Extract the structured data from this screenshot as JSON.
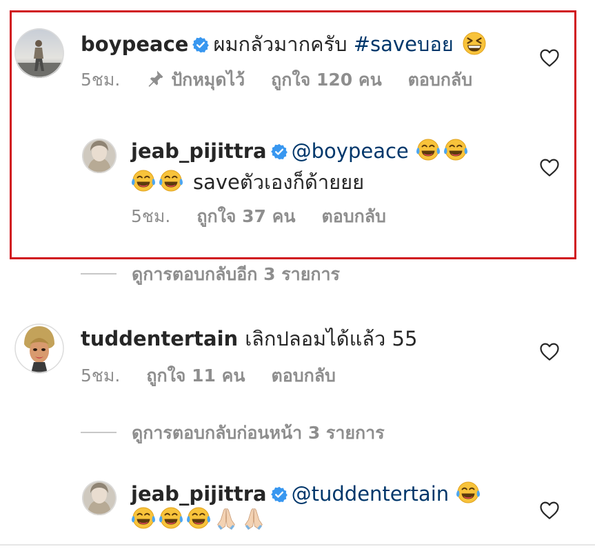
{
  "comments": [
    {
      "username": "boypeace",
      "verified": true,
      "text": "ผมกลัวมากครับ ",
      "hashtag": "#saveบอย",
      "emoji": "grinning-squinting-face",
      "time": "5ชม.",
      "pinned_label": "ปักหมุดไว้",
      "likes_label": "ถูกใจ 120 คน",
      "reply_label": "ตอบกลับ"
    },
    {
      "username": "jeab_pijittra",
      "verified": true,
      "mention": "@boypeace",
      "text_line2": "saveตัวเองก็ด้ายยย",
      "emoji": "face-with-tears-of-joy",
      "time": "5ชม.",
      "likes_label": "ถูกใจ 37 คน",
      "reply_label": "ตอบกลับ"
    },
    {
      "username": "tuddentertain",
      "verified": false,
      "text": "เลิกปลอมได้แล้ว 55",
      "time": "5ชม.",
      "likes_label": "ถูกใจ 11 คน",
      "reply_label": "ตอบกลับ"
    },
    {
      "username": "jeab_pijittra",
      "verified": true,
      "mention": "@tuddentertain",
      "emoji": "face-with-tears-of-joy",
      "emoji2": "folded-hands"
    }
  ],
  "view_more_replies": "ดูการตอบกลับอีก 3 รายการ",
  "view_previous_replies": "ดูการตอบกลับก่อนหน้า 3 รายการ",
  "colors": {
    "highlight": "#d0121b",
    "link": "#00376b",
    "verified": "#3897f0",
    "meta": "#8e8e8e"
  }
}
